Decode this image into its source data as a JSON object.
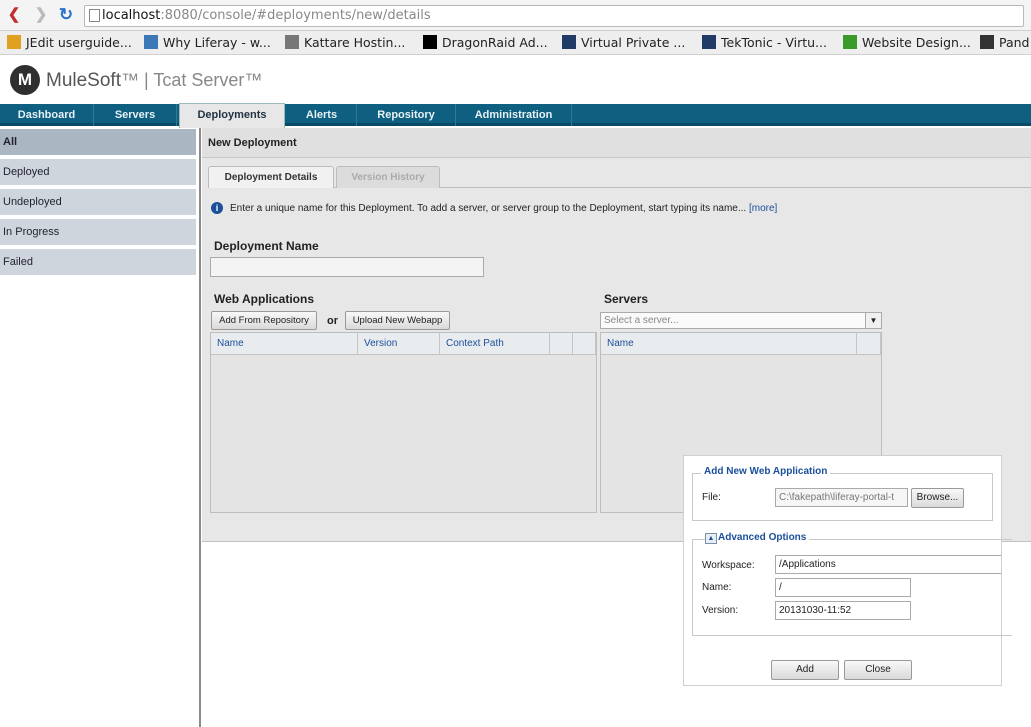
{
  "browser": {
    "url_host": "localhost",
    "url_path": ":8080/console/#deployments/new/details",
    "bookmarks": [
      {
        "label": "JEdit userguide...",
        "icon": "jedit-icon",
        "color": "#e0a020"
      },
      {
        "label": "Why Liferay - w...",
        "icon": "liferay-icon",
        "color": "#3b78b5"
      },
      {
        "label": "Kattare Hostin...",
        "icon": "kattare-icon",
        "color": "#777777"
      },
      {
        "label": "DragonRaid Ad...",
        "icon": "dragonraid-icon",
        "color": "#000000"
      },
      {
        "label": "Virtual Private ...",
        "icon": "vps-icon",
        "color": "#1f3b66"
      },
      {
        "label": "TekTonic - Virtu...",
        "icon": "tektonic-icon",
        "color": "#1f3b66"
      },
      {
        "label": "Website Design...",
        "icon": "website-design-icon",
        "color": "#3a9a2a"
      },
      {
        "label": "Pand",
        "icon": "pand-icon",
        "color": "#333333"
      }
    ]
  },
  "app": {
    "logo_letter": "M",
    "brand": "MuleSoft",
    "brand_suffix": "™ | Tcat Server™"
  },
  "tabs": [
    {
      "label": "Dashboard",
      "active": false
    },
    {
      "label": "Servers",
      "active": false
    },
    {
      "label": "Deployments",
      "active": true
    },
    {
      "label": "Alerts",
      "active": false
    },
    {
      "label": "Repository",
      "active": false
    },
    {
      "label": "Administration",
      "active": false
    }
  ],
  "sidebar": {
    "items": [
      {
        "label": "All",
        "active": true
      },
      {
        "label": "Deployed",
        "active": false
      },
      {
        "label": "Undeployed",
        "active": false
      },
      {
        "label": "In Progress",
        "active": false
      },
      {
        "label": "Failed",
        "active": false
      }
    ]
  },
  "main": {
    "title": "New Deployment",
    "subtabs": {
      "details": "Deployment Details",
      "history": "Version History"
    },
    "info_text": "Enter a unique name for this Deployment. To add a server, or server group to the Deployment, start typing its name...",
    "info_more": "[more]",
    "deployment_name_label": "Deployment Name",
    "deployment_name_value": "",
    "web_apps": {
      "title": "Web Applications",
      "add_from_repo": "Add From Repository",
      "or": "or",
      "upload": "Upload New Webapp",
      "columns": [
        "Name",
        "Version",
        "Context Path",
        "",
        ""
      ]
    },
    "servers": {
      "title": "Servers",
      "placeholder": "Select a server...",
      "columns": [
        "Name",
        ""
      ]
    }
  },
  "dialog": {
    "legend": "Add New Web Application",
    "file_label": "File:",
    "file_value": "C:\\fakepath\\liferay-portal-t",
    "browse": "Browse...",
    "advanced_legend": "Advanced Options",
    "workspace_label": "Workspace:",
    "workspace_value": "/Applications",
    "name_label": "Name:",
    "name_value": "/",
    "version_label": "Version:",
    "version_value": "20131030-11:52",
    "add": "Add",
    "close": "Close"
  },
  "colors": {
    "nav_bar": "#0e5f80",
    "sidebar": "#cfd5dc",
    "link": "#1b4f9a"
  }
}
